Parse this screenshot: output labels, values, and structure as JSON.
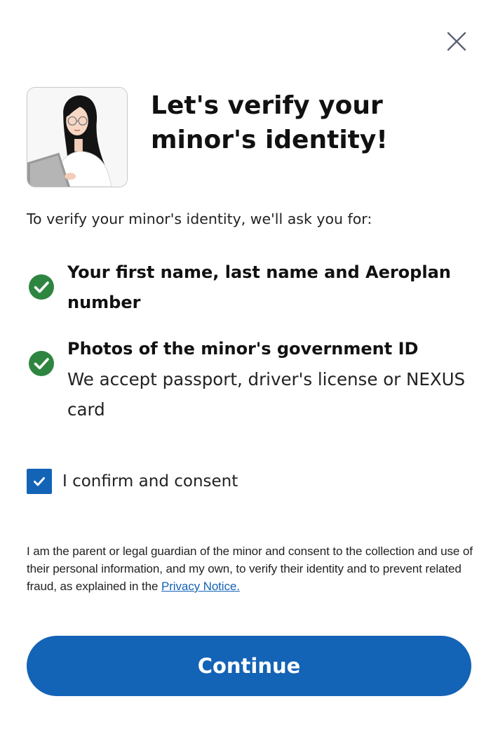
{
  "header": {
    "close_icon": "close-icon",
    "title": "Let's verify your minor's identity!"
  },
  "intro": "To verify your minor's identity, we'll ask you for:",
  "requirements": [
    {
      "icon": "check-circle-icon",
      "title": "Your first name, last name and Aeroplan number",
      "subtitle": ""
    },
    {
      "icon": "check-circle-icon",
      "title": "Photos of the minor's government ID",
      "subtitle": "We accept passport, driver's license or NEXUS card"
    }
  ],
  "consent": {
    "checked": true,
    "label": "I confirm and consent"
  },
  "legal": {
    "text": "I am the parent or legal guardian of the minor and consent to the collection and use of their personal information, and my own, to verify their identity and to prevent related fraud, as explained in the ",
    "link": "Privacy Notice."
  },
  "continue_label": "Continue",
  "colors": {
    "accent": "#1363b6",
    "check_green": "#2e8540"
  }
}
